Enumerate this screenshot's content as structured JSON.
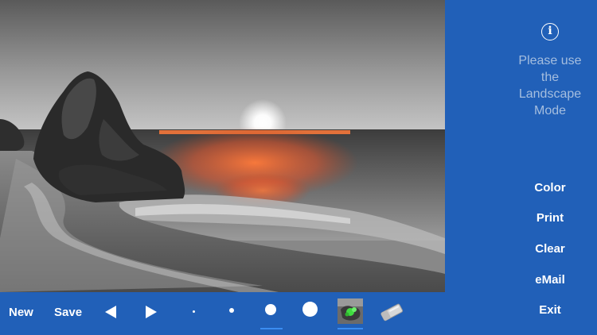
{
  "side_panel": {
    "info_icon": "info-icon",
    "hint": "Please use the Landscape Mode",
    "buttons": {
      "color": "Color",
      "print": "Print",
      "clear": "Clear",
      "email": "eMail",
      "exit": "Exit"
    }
  },
  "toolbar": {
    "new_label": "New",
    "save_label": "Save",
    "undo_icon": "triangle-left-icon",
    "redo_icon": "triangle-right-icon",
    "brush_sizes": [
      "extra-small",
      "small",
      "medium",
      "large"
    ],
    "selected_brush": "medium",
    "tools": [
      "color-brush",
      "eraser"
    ],
    "selected_tool": "color-brush"
  },
  "colors": {
    "panel_blue": "#2160b8",
    "hint_text": "#a5bedf",
    "selection_underline": "#3b8cf0",
    "sunset_orange": "#ff6a2a"
  }
}
